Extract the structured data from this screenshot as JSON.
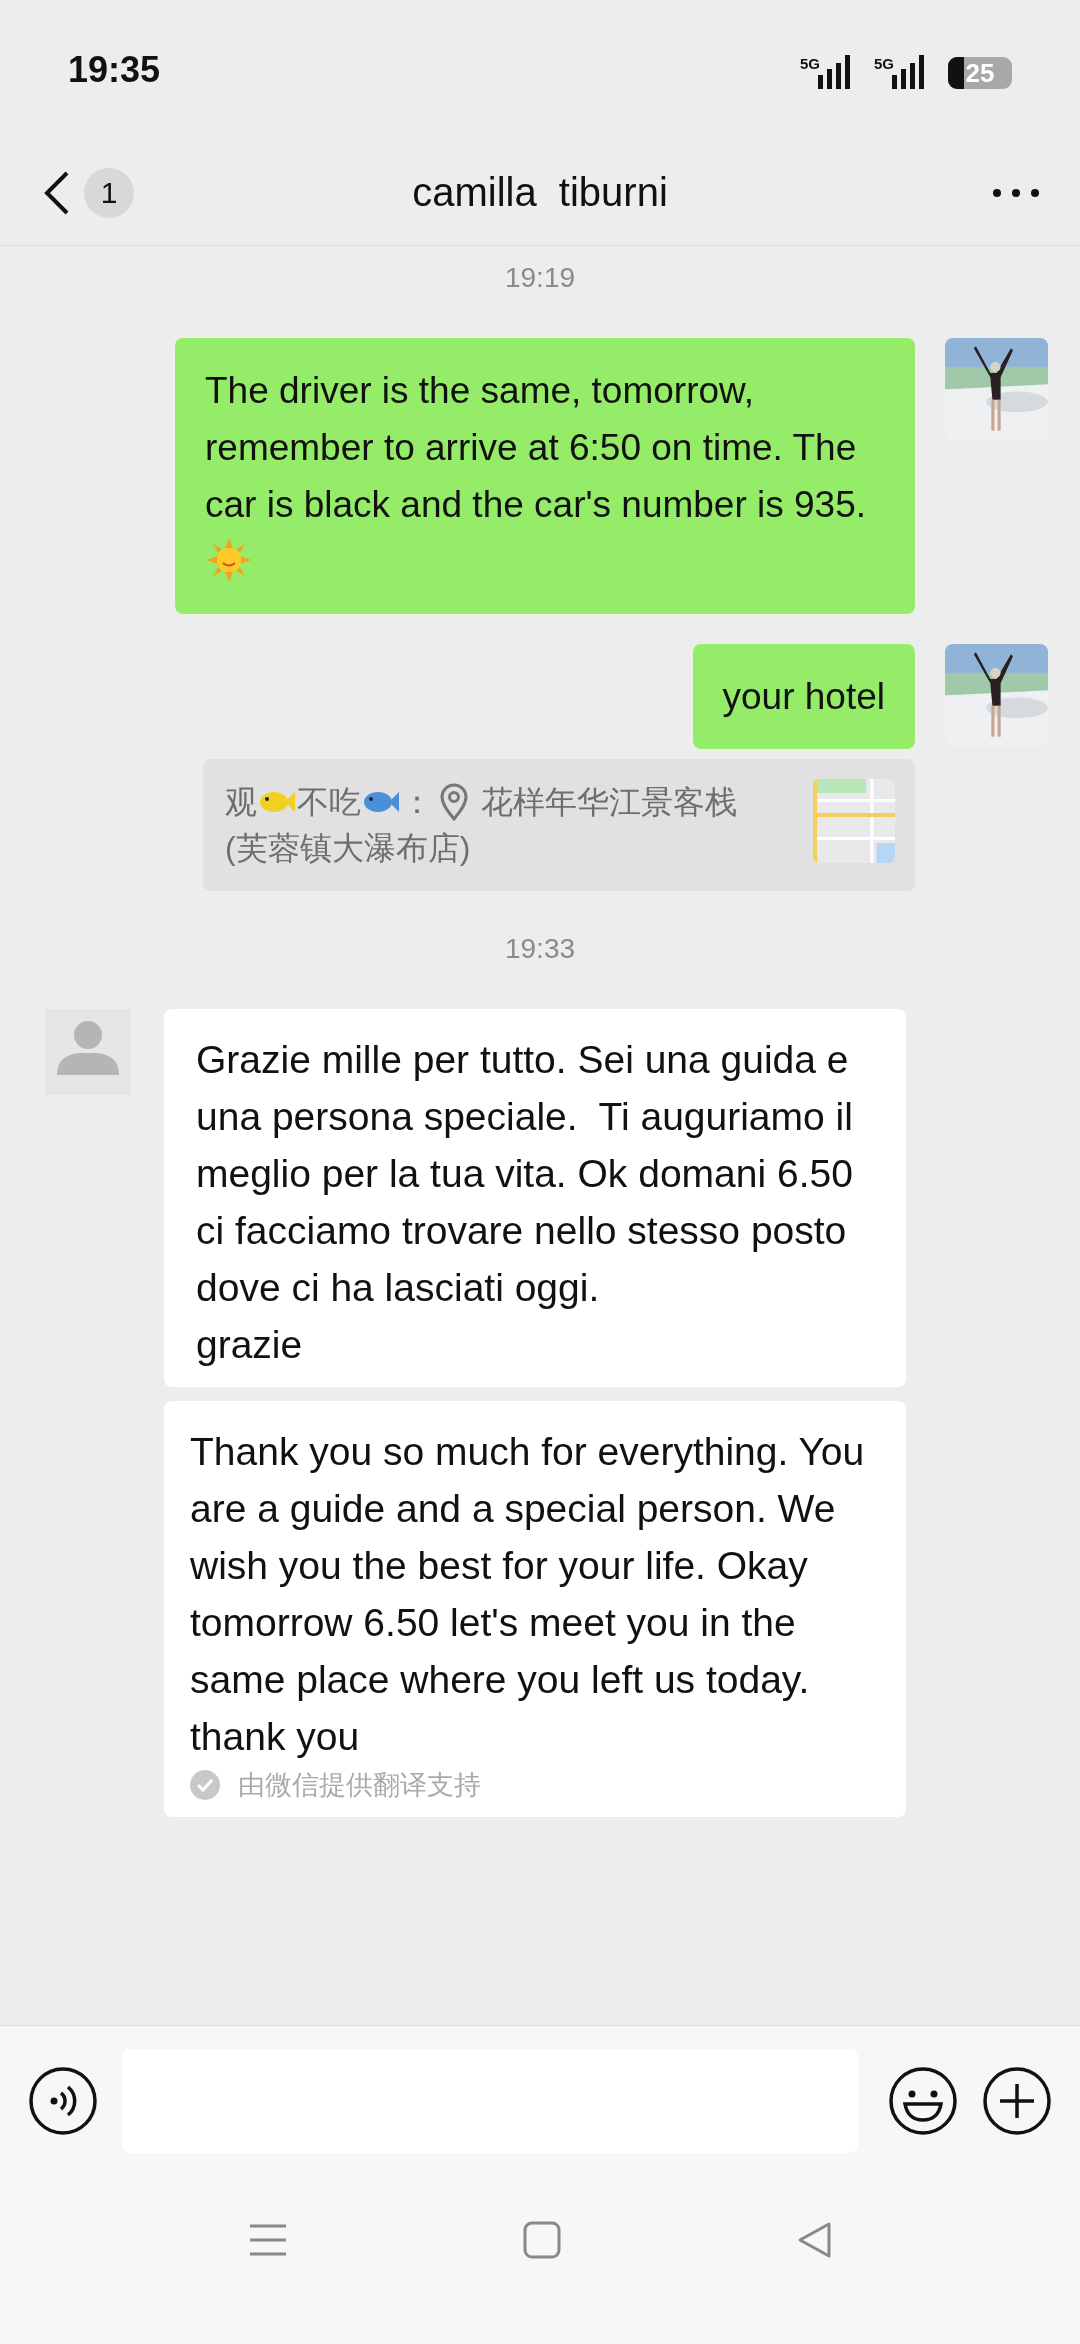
{
  "status_bar": {
    "time": "19:35",
    "networks": [
      "5G",
      "5G"
    ],
    "battery": "25"
  },
  "header": {
    "unread": "1",
    "title": "camilla  tiburni"
  },
  "chat": [
    {
      "kind": "time",
      "text": "19:19"
    },
    {
      "kind": "sent",
      "text": "The driver is the same, tomorrow, remember to arrive at 6:50 on time. The car is black and the car's number is 935.",
      "trailing_emoji": true
    },
    {
      "kind": "sent",
      "text": "your hotel"
    },
    {
      "kind": "quote",
      "sender_parts": [
        {
          "kind": "text",
          "text": "观"
        },
        {
          "kind": "fish",
          "color": "#f2d022"
        },
        {
          "kind": "text",
          "text": "不吃"
        },
        {
          "kind": "fish",
          "color": "#4a90d9"
        },
        {
          "kind": "text",
          "text": "："
        }
      ],
      "place": [
        "花样年华江景客栈",
        "(芙蓉镇大瀑布店)"
      ]
    },
    {
      "kind": "time",
      "text": "19:33"
    },
    {
      "kind": "received",
      "text": "Grazie mille per tutto. Sei una guida e una persona speciale.  Ti auguriamo il meglio per la tua vita. Ok domani 6.50 ci facciamo trovare nello stesso posto dove ci ha lasciati oggi.\ngrazie"
    },
    {
      "kind": "translation",
      "text": "Thank you so much for everything. You are a guide and a special person. We wish you the best for your life. Okay tomorrow 6.50 let's meet you in the same place where you left us today.\nthank you",
      "footer": "由微信提供翻译支持"
    }
  ]
}
